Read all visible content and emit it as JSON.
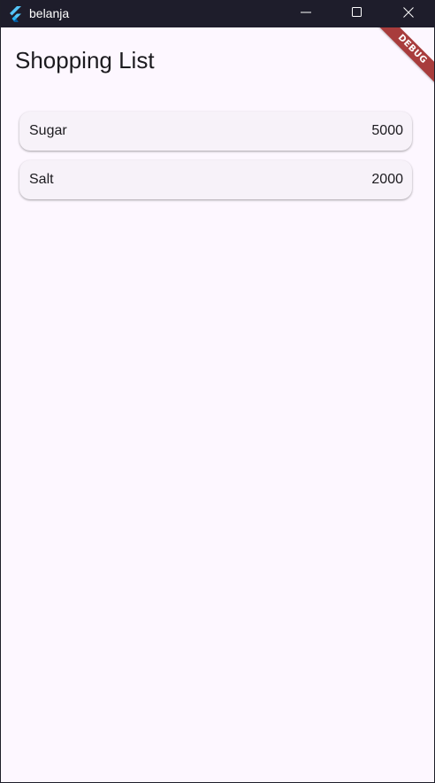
{
  "window": {
    "title": "belanja",
    "colors": {
      "titlebar": "#1e1d2b",
      "background": "#fdf7ff",
      "card": "#f7f2f9",
      "debug_banner": "#a83c3c",
      "flutter_logo": "#54c5f8"
    }
  },
  "appbar": {
    "title": "Shopping List"
  },
  "items": [
    {
      "name": "Sugar",
      "price": "5000"
    },
    {
      "name": "Salt",
      "price": "2000"
    }
  ],
  "debug_banner": {
    "label": "DEBUG"
  }
}
